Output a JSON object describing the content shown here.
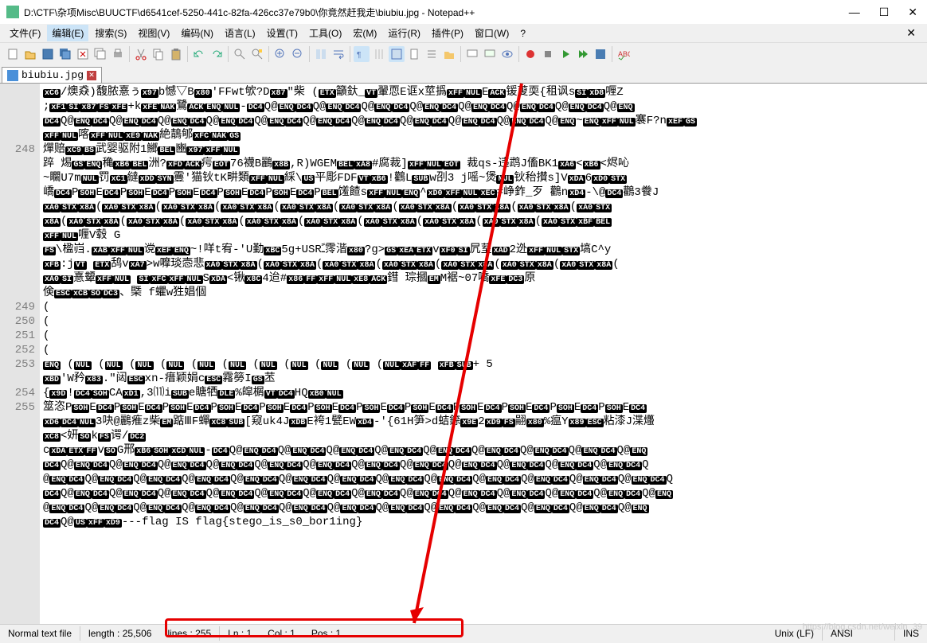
{
  "title": "D:\\CTF\\杂项Misc\\BUUCTF\\d6541cef-5250-441c-82fa-426cc37e79b0\\你竟然赶我走\\biubiu.jpg - Notepad++",
  "menu": {
    "file": "文件(F)",
    "edit": "编辑(E)",
    "search": "搜索(S)",
    "view": "视图(V)",
    "encoding": "编码(N)",
    "language": "语言(L)",
    "settings": "设置(T)",
    "tools": "工具(O)",
    "macro": "宏(M)",
    "run": "运行(R)",
    "plugins": "插件(P)",
    "window": "窗口(W)",
    "help": "?"
  },
  "tab": {
    "label": "biubiu.jpg"
  },
  "gutter": {
    "l248": "248",
    "l249": "249",
    "l250": "250",
    "l251": "251",
    "l252": "252",
    "l253": "253",
    "l254": "254",
    "l255": "255"
  },
  "code": {
    "r1": [
      "xC6",
      "/燠猋)馥脓憙ぅ",
      "x97",
      "b憾▽B",
      "x80",
      "'FF",
      "wt欨?D",
      "x87",
      "\"柴 (",
      "ETX",
      "籲釱_",
      "VT",
      "翬恧E诓x莖撝",
      "xFF",
      "NUL",
      "E",
      "ACK",
      "锾蓃耎{租讽s",
      "SI",
      "xD8",
      "喱Z"
    ],
    "r2": [
      ";",
      "xF1",
      "SI",
      "x87",
      "FS",
      "xFE",
      "+k",
      "xFE",
      "NAK",
      "鷺",
      "ACK",
      "ENQ",
      "NUL",
      "-",
      "DC4",
      "Q@",
      "ENQ",
      "DC4",
      "Q@",
      "ENQ",
      "DC4",
      "Q@",
      "ENQ",
      "DC4",
      "Q@",
      "ENQ",
      "DC4",
      "Q@",
      "ENQ",
      "DC4",
      "Q@",
      "ENQ",
      "DC4",
      "Q@",
      "ENQ",
      "DC4",
      "Q@",
      "ENQ"
    ],
    "r3": [
      "DC4",
      "Q@",
      "ENQ",
      "DC4",
      "Q@",
      "ENQ",
      "DC4",
      "Q@",
      "ENQ",
      "DC4",
      "Q@",
      "ENQ",
      "DC4",
      "Q@",
      "ENQ",
      "DC4",
      "Q@",
      "ENQ",
      "DC4",
      "Q@",
      "ENQ",
      "DC4",
      "Q@",
      "ENQ",
      "DC4",
      "Q@",
      "ENQ",
      "DC4",
      "Q@",
      "ENQ",
      "DC4",
      "Q@",
      "ENQ",
      "~",
      "ENQ",
      "xFF",
      "NUL",
      "褰F?n",
      "xEF",
      "GS"
    ],
    "r4": [
      "xFF",
      "NUL",
      "喀",
      "xFF",
      "NUL",
      "xE9",
      "NAK",
      "絶鶄郇",
      "xFC",
      "NAK",
      "GS"
    ],
    "r5": [
      "燀赔",
      "xC9",
      "BS",
      "武婴驱附1鱜",
      "BEL",
      "豳",
      "x97",
      "xFF",
      "NUL"
    ],
    "r6": [
      "踤  焬",
      "GS",
      "ENQ",
      "穐",
      "xB6",
      "BEL",
      "洲?",
      "xFD",
      "ACK",
      "疞",
      "EOT",
      "76襪B鸝",
      "x8B",
      ",R)WGEM",
      "BEL",
      "xA8",
      "#腐裁]",
      "xFF",
      "NUL",
      "EOT",
      "  裁qs-违鹉J傗",
      "BK1",
      "xA6",
      "<",
      "xB6",
      "<烬吣"
    ],
    "r7": [
      "~矙U7m",
      "NUL",
      "罚",
      "xC1",
      "繨",
      "xDD",
      "SYN",
      "霻",
      "'猫钬tK畊類",
      "xFF",
      "NUL",
      "綵\\",
      "US",
      "平彫",
      "FDF",
      "VT",
      "xB6",
      "!鸛L",
      "SUB",
      "w刟3  j嗂",
      "~",
      "煲",
      "NUL",
      "钬秮攅s]V",
      "xDA",
      "6",
      "xD0",
      "STX"
    ],
    "r8": [
      "嶠",
      "DC4",
      "P",
      "SOH",
      "E",
      "DC4",
      "P",
      "SOH",
      "E",
      "DC4",
      "P",
      "SOH",
      "E",
      "DC4",
      "P",
      "SOH",
      "E",
      "DC4",
      "P",
      "SOH",
      "E",
      "DC4",
      "P",
      "BEL",
      "馐餷s",
      "xFF",
      "NUL",
      "ENQ",
      "^",
      "xD0",
      "xFF",
      "NUL",
      "xEC",
      "=峥鈼_歹  鸛n",
      "xD4",
      "-\\@",
      "DC4",
      "鸛3餋J"
    ],
    "r9": [
      "xA0",
      "STX",
      "x8A",
      "(",
      "xA0",
      "STX",
      "x8A",
      "(",
      "xA0",
      "STX",
      "x8A",
      "(",
      "xA0",
      "STX",
      "x8A",
      "(",
      "xA0",
      "STX",
      "x8A",
      "(",
      "xA0",
      "STX",
      "x8A",
      "(",
      "xA0",
      "STX",
      "x8A",
      "(",
      "xA0",
      "STX",
      "x8A",
      "(",
      "xA0",
      "STX",
      "x8A",
      "(",
      "xA0",
      "STX"
    ],
    "r10": [
      "x8A",
      "(",
      "xA0",
      "STX",
      "x8A",
      "(",
      "xA0",
      "STX",
      "x8A",
      "(",
      "xA0",
      "STX",
      "x8A",
      "(",
      "xA0",
      "STX",
      "x8A",
      "(",
      "xA0",
      "STX",
      "x8A",
      "(",
      "xA0",
      "STX",
      "x8A",
      "(",
      "xA0",
      "STX",
      "x8A",
      "(",
      "xA0",
      "STX",
      "x8A",
      "(",
      "xA0",
      "STX",
      "xBF",
      "BEL"
    ],
    "r11": [
      "xFF",
      "NUL",
      "喱V毂  ",
      "G"
    ],
    "r12": [
      "FS",
      "\\楹",
      "岿.",
      "xAB",
      "xFF",
      "NUL",
      "谠",
      "xEF",
      "ENQ",
      "~!",
      "咩t宥",
      "-'U勤",
      "xBC",
      "5g+",
      "USR",
      "ﹱ霗湝",
      "x80",
      "?g>",
      "GS",
      "xEA",
      "ETX",
      "v",
      "xF0",
      "SI",
      "凥荎",
      "xAD",
      "2迯",
      "xFF",
      "NUL",
      "STX",
      "塙",
      "C^y"
    ],
    "r13": [
      "xFB",
      ":j",
      "VT",
      "  ",
      "ETX",
      "鸹v",
      "xA7",
      ">w嚤琰悫悲",
      "xA0",
      "STX",
      "x8A",
      "(",
      "xA0",
      "STX",
      "x8A",
      "(",
      "xA0",
      "STX",
      "x8A",
      "(",
      "xA0",
      "STX",
      "x8A",
      "(",
      "xA0",
      "STX",
      "x8A",
      "(",
      "xA0",
      "STX",
      "x8A",
      "(",
      "xA0",
      "STX",
      "x8A",
      "("
    ],
    "r14": [
      "xA0",
      "SI",
      "憙顰",
      "xFF",
      "NUL",
      "  ",
      "SI",
      "xFC",
      "xFF",
      "NUL",
      "S",
      "xDA",
      "<锹",
      "x8C",
      "4迨#",
      "x86",
      "FF",
      "xFF",
      "NUL",
      "xE8",
      "ACK",
      "鏏  琮摑",
      "EM",
      "M裾~07嘺",
      "xFE",
      "DC3",
      "原"
    ],
    "r15": [
      "倹",
      "ESC",
      "xCB",
      "SO",
      "DC3",
      "、槩  f蠷w狌娼個"
    ],
    "r16": [
      "("
    ],
    "r17": [
      "("
    ],
    "r18": [
      "("
    ],
    "r19": [
      "("
    ],
    "r20": [
      "ENQ",
      "  (",
      "NUL",
      "  (",
      "NUL",
      "  (",
      "NUL",
      "  (",
      "NUL",
      "  (",
      "NUL",
      "  (",
      "NUL",
      "  (",
      "NUL",
      "  (",
      "NUL",
      "  (",
      "NUL",
      "  (",
      "NUL",
      "  (",
      "NUL",
      "xAF",
      "FF",
      "  ",
      "xFB",
      "SUB",
      "+  5"
    ],
    "r21": [
      "xBD",
      "'W矜",
      "x83",
      ".\"闼",
      "ESC",
      "xn-瘄颖娟c",
      "ESC",
      "霿簩I",
      "GS",
      "苤"
    ],
    "r22": [
      "{",
      "x9D",
      "!",
      "DC4",
      "SOH",
      "CA",
      "xD1",
      ",",
      "3⑾i",
      "SUB",
      "e瞊牺",
      "DLE",
      "%皡榍",
      "VT",
      "DC4",
      "H",
      "Q",
      "xB0",
      "NUL"
    ],
    "r23": [
      "筮恣",
      "P",
      "SOH",
      "E",
      "DC4",
      "P",
      "SOH",
      "E",
      "DC4",
      "P",
      "SOH",
      "E",
      "DC4",
      "P",
      "SOH",
      "E",
      "DC4",
      "P",
      "SOH",
      "E",
      "DC4",
      "P",
      "SOH",
      "E",
      "DC4",
      "P",
      "SOH",
      "E",
      "DC4",
      "P",
      "SOH",
      "E",
      "DC4",
      "P",
      "SOH",
      "E",
      "DC4",
      "P",
      "SOH",
      "E",
      "DC4",
      "P",
      "SOH",
      "E",
      "DC4",
      "P",
      "SOH",
      "E",
      "DC4"
    ],
    "r24": [
      "xD6",
      "DC4",
      "NUL",
      "3吷@鸝痽z柴",
      "EM",
      "踮ⅢF蟬",
      "xC8",
      "SUB",
      "[窥uk4J",
      "xDB",
      "E",
      "袴1甓",
      "EW",
      "xD4",
      "-'{61H笋>d蛣錼",
      "x9E",
      "2",
      "xD9",
      "FS",
      "翤",
      "x80",
      "%瘟Y",
      "x89",
      "ESC",
      "粘漆J渫爡"
    ],
    "r25": [
      "xC8",
      "<妍",
      "SO",
      "k",
      "FS",
      "谔",
      "",
      "/",
      "DC2"
    ],
    "r26": [
      "c",
      "xDA",
      "ETX",
      "FF",
      "v",
      "SO",
      "G邢",
      "xB6",
      "SOH",
      "xCD",
      "NUL",
      "-",
      "DC4",
      "Q@",
      "ENQ",
      "DC4",
      "Q@",
      "ENQ",
      "DC4",
      "Q@",
      "ENQ",
      "DC4",
      "Q@",
      "ENQ",
      "DC4",
      "Q@",
      "ENQ",
      "DC4",
      "Q@",
      "ENQ",
      "DC4",
      "Q@",
      "ENQ",
      "DC4",
      "Q@",
      "ENQ",
      "DC4",
      "Q@",
      "ENQ"
    ],
    "r27": [
      "DC4",
      "Q@",
      "ENQ",
      "DC4",
      "Q@",
      "ENQ",
      "DC4",
      "Q@",
      "ENQ",
      "DC4",
      "Q@",
      "ENQ",
      "DC4",
      "Q@",
      "ENQ",
      "DC4",
      "Q@",
      "ENQ",
      "DC4",
      "Q@",
      "ENQ",
      "DC4",
      "Q@",
      "ENQ",
      "DC4",
      "Q@",
      "ENQ",
      "DC4",
      "Q@",
      "ENQ",
      "DC4",
      "Q@",
      "ENQ",
      "DC4",
      "Q@",
      "ENQ",
      "DC4",
      "Q"
    ],
    "r28": [
      "@",
      "ENQ",
      "DC4",
      "Q@",
      "ENQ",
      "DC4",
      "Q@",
      "ENQ",
      "DC4",
      "Q@",
      "ENQ",
      "DC4",
      "Q@",
      "ENQ",
      "DC4",
      "Q@",
      "ENQ",
      "DC4",
      "Q@",
      "ENQ",
      "DC4",
      "Q@",
      "ENQ",
      "DC4",
      "Q@",
      "ENQ",
      "DC4",
      "Q@",
      "ENQ",
      "DC4",
      "Q@",
      "ENQ",
      "DC4",
      "Q@",
      "ENQ",
      "DC4",
      "Q@",
      "ENQ",
      "DC4",
      "Q"
    ],
    "r29": [
      "DC4",
      "Q@",
      "ENQ",
      "DC4",
      "Q@",
      "ENQ",
      "DC4",
      "Q@",
      "ENQ",
      "DC4",
      "Q@",
      "ENQ",
      "DC4",
      "Q@",
      "ENQ",
      "DC4",
      "Q@",
      "ENQ",
      "DC4",
      "Q@",
      "ENQ",
      "DC4",
      "Q@",
      "ENQ",
      "DC4",
      "Q@",
      "ENQ",
      "DC4",
      "Q@",
      "ENQ",
      "DC4",
      "Q@",
      "ENQ",
      "DC4",
      "Q@",
      "ENQ",
      "DC4",
      "Q@",
      "ENQ"
    ],
    "r30": [
      "@",
      "ENQ",
      "DC4",
      "Q@",
      "ENQ",
      "DC4",
      "Q@",
      "ENQ",
      "DC4",
      "Q@",
      "ENQ",
      "DC4",
      "Q@",
      "ENQ",
      "DC4",
      "Q@",
      "ENQ",
      "DC4",
      "Q@",
      "ENQ",
      "DC4",
      "Q@",
      "ENQ",
      "DC4",
      "Q@",
      "ENQ",
      "DC4",
      "Q@",
      "ENQ",
      "DC4",
      "Q@",
      "ENQ",
      "DC4",
      "Q@",
      "ENQ",
      "DC4",
      "Q@",
      "ENQ"
    ],
    "r31": [
      "DC4",
      "Q@",
      "US",
      "xFF",
      "xD9",
      "---",
      "flag IS flag{stego_is_s0_bor1ing}"
    ]
  },
  "status": {
    "type": "Normal text file",
    "length": "length : 25,506",
    "lines": "lines : 255",
    "ln": "Ln : 1",
    "col": "Col : 1",
    "pos": "Pos : 1",
    "eol": "Unix (LF)",
    "enc": "ANSI",
    "ins": "INS"
  },
  "watermark": "https://blog.csdn.net/weixin_39"
}
